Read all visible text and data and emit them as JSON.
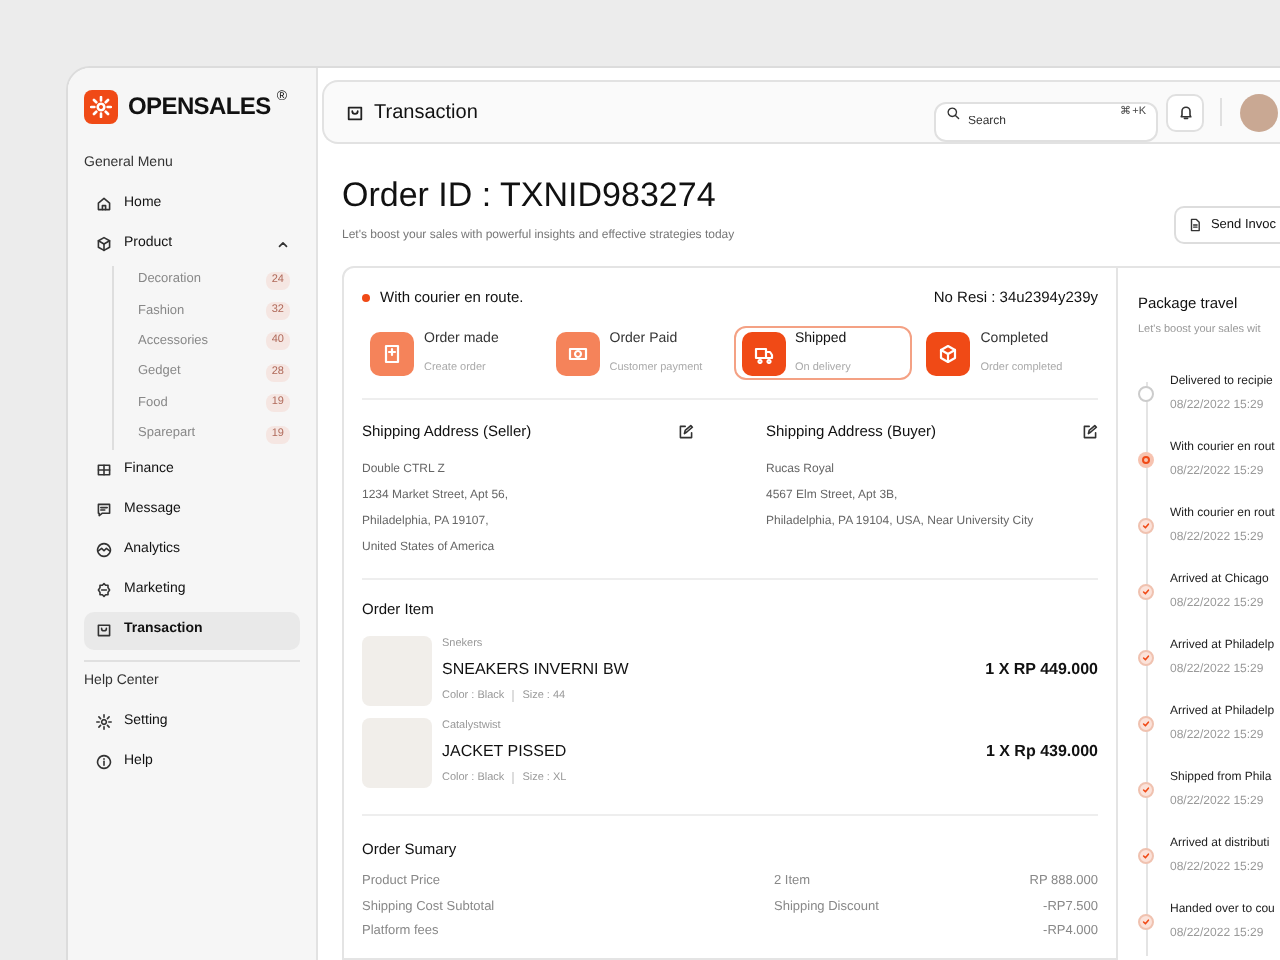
{
  "brand": {
    "name": "OPENSALES",
    "mark": "®"
  },
  "sidebar": {
    "sections": [
      {
        "title": "General Menu",
        "items": [
          {
            "label": "Home",
            "selected": false
          },
          {
            "label": "Product",
            "selected": false,
            "expanded": true,
            "children": [
              {
                "label": "Decoration",
                "count": "24"
              },
              {
                "label": "Fashion",
                "count": "32"
              },
              {
                "label": "Accessories",
                "count": "40"
              },
              {
                "label": "Gedget",
                "count": "28"
              },
              {
                "label": "Food",
                "count": "19"
              },
              {
                "label": "Sparepart",
                "count": "19"
              }
            ]
          },
          {
            "label": "Finance",
            "selected": false
          },
          {
            "label": "Message",
            "selected": false
          },
          {
            "label": "Analytics",
            "selected": false
          },
          {
            "label": "Marketing",
            "selected": false
          },
          {
            "label": "Transaction",
            "selected": true
          }
        ]
      },
      {
        "title": "Help Center",
        "items": [
          {
            "label": "Setting",
            "selected": false
          },
          {
            "label": "Help",
            "selected": false
          }
        ]
      }
    ]
  },
  "header": {
    "title": "Transaction",
    "search": {
      "placeholder": "Search",
      "shortcut": "⌘+K"
    }
  },
  "order": {
    "title": "Order ID : TXNID983274",
    "subtitle": "Let's boost your sales with powerful insights and effective strategies today",
    "send_button": "Send Invoc"
  },
  "status": {
    "text": "With courier en route.",
    "resi": "No Resi : 34u2394y239y"
  },
  "steps": [
    {
      "title": "Order made",
      "caption": "Create order",
      "color": "#f5835a",
      "selected": false
    },
    {
      "title": "Order Paid",
      "caption": "Customer payment",
      "color": "#f5835a",
      "selected": false
    },
    {
      "title": "Shipped",
      "caption": "On delivery",
      "color": "#f04a16",
      "selected": true
    },
    {
      "title": "Completed",
      "caption": "Order completed",
      "color": "#f04a16",
      "selected": false
    }
  ],
  "addresses": [
    {
      "title": "Shipping Address (Seller)",
      "lines": [
        "Double CTRL  Z",
        "1234 Market Street, Apt 56,",
        "Philadelphia, PA 19107,",
        "United States of America"
      ]
    },
    {
      "title": "Shipping Address (Buyer)",
      "lines": [
        "Rucas Royal",
        "4567 Elm Street,  Apt 3B,",
        "Philadelphia, PA 19104, USA, Near University City"
      ]
    }
  ],
  "order_items": {
    "title": "Order Item",
    "items": [
      {
        "brand": "Snekers",
        "name": "SNEAKERS INVERNI BW",
        "color_text": "Color : Black",
        "size_text": "Size : 44",
        "price": "1 X RP 449.000"
      },
      {
        "brand": "Catalystwist",
        "name": "JACKET PISSED",
        "color_text": "Color : Black",
        "size_text": "Size : XL",
        "price": "1 X Rp 439.000"
      }
    ]
  },
  "summary": {
    "title": "Order Sumary",
    "rows": [
      {
        "label": "Product Price",
        "detail": "2 Item",
        "amount": "RP 888.000"
      },
      {
        "label": "Shipping Cost Subtotal",
        "detail": "Shipping Discount",
        "amount": "-RP7.500"
      },
      {
        "label": "Platform fees",
        "amount": "-RP4.000"
      }
    ]
  },
  "package_travel": {
    "title": "Package travel",
    "subtitle": "Let's boost your sales wit",
    "events": [
      {
        "text": "Delivered to recipie",
        "time": "08/22/2022 15:29",
        "kind": "pending"
      },
      {
        "text": "With courier en rout",
        "time": "08/22/2022 15:29",
        "kind": "current"
      },
      {
        "text": "With courier en rout",
        "time": "08/22/2022 15:29",
        "kind": "done"
      },
      {
        "text": "Arrived at Chicago",
        "time": "08/22/2022 15:29",
        "kind": "done"
      },
      {
        "text": "Arrived at Philadelp",
        "time": "08/22/2022 15:29",
        "kind": "done"
      },
      {
        "text": "Arrived at Philadelp",
        "time": "08/22/2022 15:29",
        "kind": "done"
      },
      {
        "text": "Shipped from Phila",
        "time": "08/22/2022 15:29",
        "kind": "done"
      },
      {
        "text": "Arrived at distributi",
        "time": "08/22/2022 15:29",
        "kind": "done"
      },
      {
        "text": "Handed over to cou",
        "time": "08/22/2022 15:29",
        "kind": "done"
      }
    ]
  }
}
